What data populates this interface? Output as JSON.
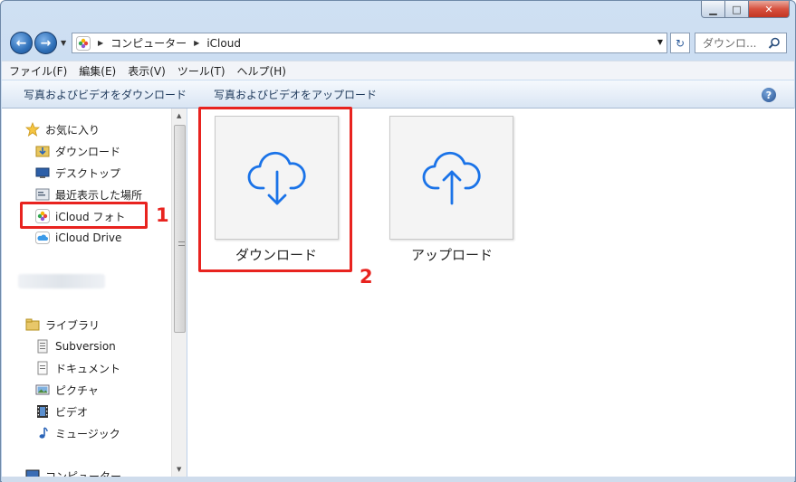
{
  "window": {
    "caption_min": "▁",
    "caption_max": "□",
    "caption_close": "✕"
  },
  "address": {
    "path": [
      "コンピューター",
      "iCloud"
    ]
  },
  "search": {
    "placeholder": "ダウンロ..."
  },
  "menu": [
    "ファイル(F)",
    "編集(E)",
    "表示(V)",
    "ツール(T)",
    "ヘルプ(H)"
  ],
  "commands": [
    "写真およびビデオをダウンロード",
    "写真およびビデオをアップロード"
  ],
  "help_label": "?",
  "nav": {
    "favorites_label": "お気に入り",
    "favorites": [
      "ダウンロード",
      "デスクトップ",
      "最近表示した場所",
      "iCloud フォト",
      "iCloud Drive"
    ],
    "libraries_label": "ライブラリ",
    "libraries": [
      "Subversion",
      "ドキュメント",
      "ピクチャ",
      "ビデオ",
      "ミュージック"
    ],
    "computer_label": "コンピューター"
  },
  "content": {
    "download_label": "ダウンロード",
    "upload_label": "アップロード"
  },
  "annotations": {
    "step1": "1",
    "step2": "2",
    "color": "#e8231f"
  },
  "colors": {
    "accent": "#1a73e8",
    "command_text": "#1e395b"
  }
}
